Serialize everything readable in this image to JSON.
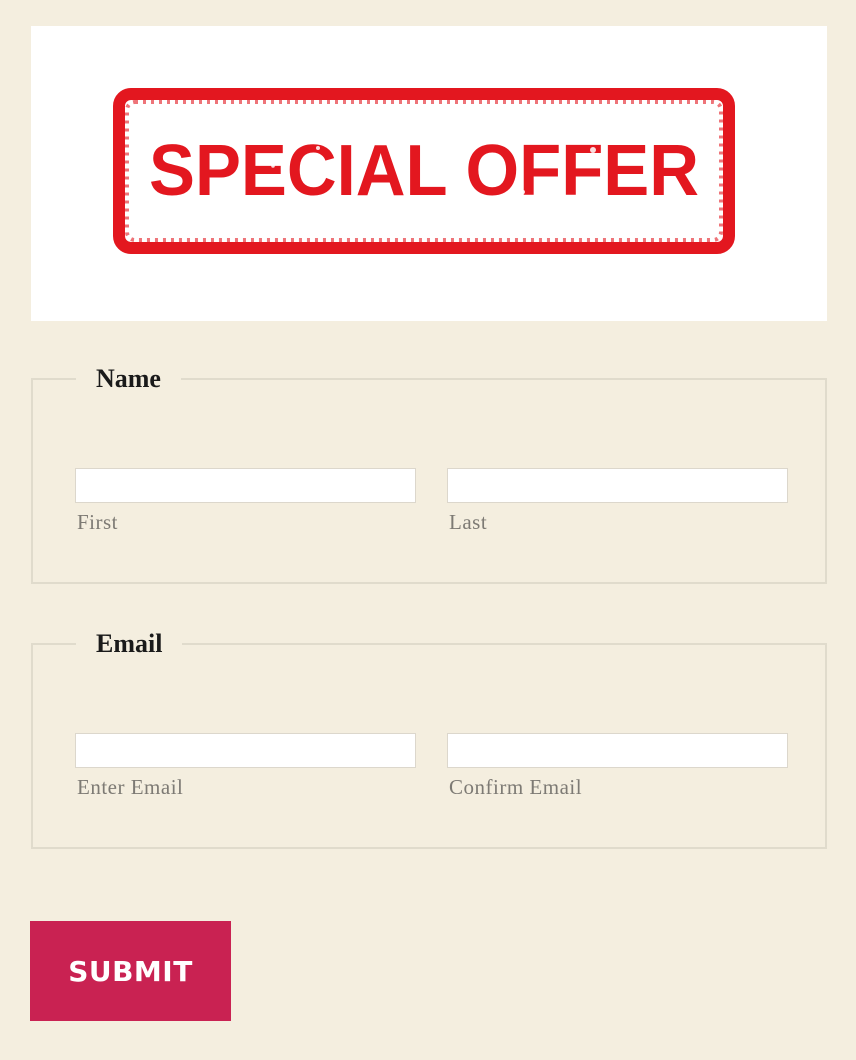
{
  "banner": {
    "stamp_text": "SPECIAL OFFER",
    "stamp_color": "#e3171f"
  },
  "name_group": {
    "legend": "Name",
    "first_label": "First",
    "last_label": "Last",
    "first_value": "",
    "last_value": ""
  },
  "email_group": {
    "legend": "Email",
    "enter_label": "Enter Email",
    "confirm_label": "Confirm Email",
    "enter_value": "",
    "confirm_value": ""
  },
  "submit": {
    "label": "SUBMIT",
    "color": "#c92252"
  },
  "colors": {
    "page_background": "#f4eedf",
    "field_border": "#dcd7cc",
    "sublabel": "#7d7a74"
  }
}
